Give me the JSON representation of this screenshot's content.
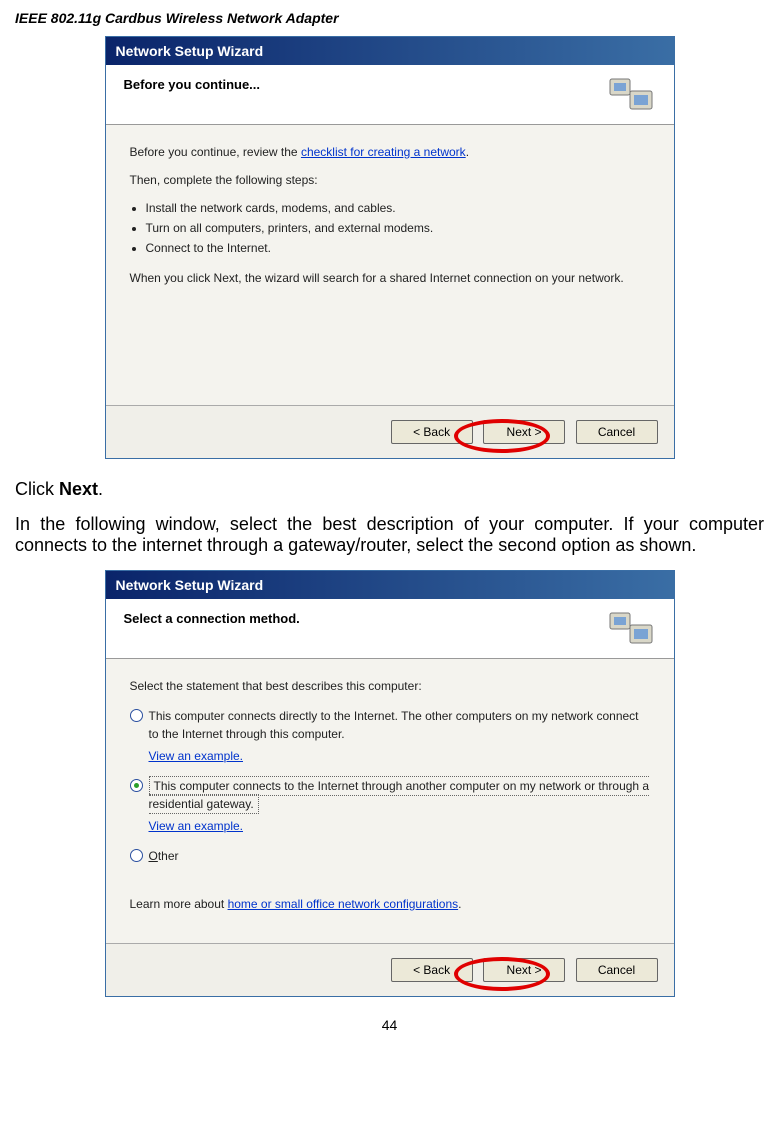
{
  "header": "IEEE 802.11g Cardbus Wireless Network Adapter",
  "wiz1": {
    "title": "Network Setup Wizard",
    "heading": "Before you continue...",
    "body": {
      "intro_pre": "Before you continue, review the ",
      "intro_link": "checklist for creating a network",
      "intro_post": ".",
      "steps_lead": "Then, complete the following steps:",
      "bullets": [
        "Install the network cards, modems, and cables.",
        "Turn on all computers, printers, and external modems.",
        "Connect to the Internet."
      ],
      "note": "When you click Next, the wizard will search for a shared Internet connection on your network."
    },
    "buttons": {
      "back": "< Back",
      "next": "Next >",
      "cancel": "Cancel"
    }
  },
  "instr1": {
    "pre": "Click ",
    "bold": "Next",
    "post": "."
  },
  "instr2": "In the following window, select the best description of your computer.  If your computer connects to the internet through a gateway/router, select the second option as shown.",
  "wiz2": {
    "title": "Network Setup Wizard",
    "heading": "Select a connection method.",
    "body": {
      "select_lead": "Select the statement that best describes this computer:",
      "opt1": "This computer connects directly to the Internet. The other computers on my network connect to the Internet through this computer.",
      "opt2": "This computer connects to the Internet through another computer on my network or through a residential gateway.",
      "opt3_label": "O",
      "opt3": "ther",
      "view_ex": "View an example.",
      "learn_pre": "Learn more about ",
      "learn_link": "home or small office network configurations",
      "learn_post": "."
    },
    "buttons": {
      "back": "< Back",
      "next": "Next >",
      "cancel": "Cancel"
    }
  },
  "pagenum": "44"
}
